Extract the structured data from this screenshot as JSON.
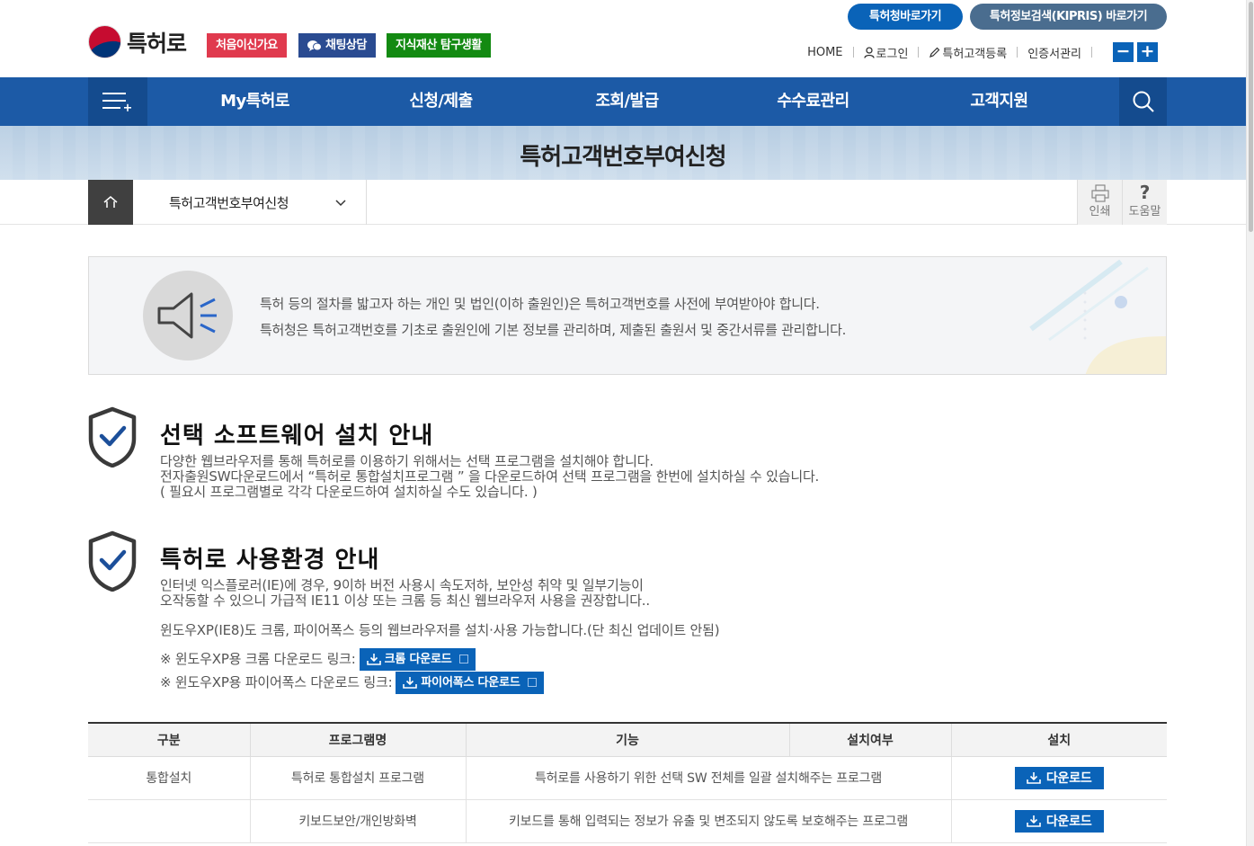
{
  "header": {
    "logo_text": "특허로",
    "tags": {
      "first_visit": "처음이신가요",
      "chat": "채팅상담",
      "ip_life": "지식재산 탐구생활"
    },
    "pills": {
      "kipo": "특허청바로가기",
      "kipris": "특허정보검색(KIPRIS) 바로가기"
    },
    "util": {
      "home": "HOME",
      "login": "로그인",
      "register": "특허고객등록",
      "cert": "인증서관리",
      "zoom_out": "−",
      "zoom_in": "+"
    }
  },
  "nav": {
    "items": [
      "My특허로",
      "신청/제출",
      "조회/발급",
      "수수료관리",
      "고객지원"
    ]
  },
  "banner": {
    "title": "특허고객번호부여신청"
  },
  "breadcrumb": {
    "current": "특허고객번호부여신청",
    "print": "인쇄",
    "help_symbol": "?",
    "help": "도움말"
  },
  "notice": {
    "line1": "특허 등의 절차를 밟고자 하는 개인 및 법인(이하 출원인)은 특허고객번호를 사전에 부여받아야 합니다.",
    "line2": "특허청은 특허고객번호를 기초로 출원인에 기본 정보를 관리하며, 제출된 출원서 및 중간서류를 관리합니다."
  },
  "section_sw": {
    "title": "선택 소프트웨어 설치 안내",
    "line1": "다양한 웹브라우저를 통해 특허로를 이용하기 위해서는 선택 프로그램을 설치해야 합니다.",
    "line2": "전자출원SW다운로드에서 “특허로 통합설치프로그램 ” 을 다운로드하여 선택 프로그램을 한번에 설치하실 수 있습니다.",
    "line3": "( 필요시 프로그램별로 각각 다운로드하여 설치하실 수도 있습니다. )"
  },
  "section_env": {
    "title": "특허로 사용환경 안내",
    "line1": "인터넷 익스플로러(IE)에 경우, 9이하 버전 사용시 속도저하, 보안성 취약 및 일부기능이",
    "line2": "오작동할 수 있으니 가급적 IE11 이상 또는 크롬 등 최신 웹브라우저 사용을 권장합니다..",
    "line3": "윈도우XP(IE8)도 크롬, 파이어폭스 등의 웹브라우저를 설치·사용 가능합니다.(단 최신 업데이트 안됨)",
    "chrome_label": "※ 윈도우XP용 크롬 다운로드 링크:",
    "chrome_btn": "크롬 다운로드",
    "firefox_label": "※ 윈도우XP용 파이어폭스 다운로드 링크:",
    "firefox_btn": "파이어폭스 다운로드"
  },
  "table": {
    "headers": [
      "구분",
      "프로그램명",
      "기능",
      "설치여부",
      "설치"
    ],
    "rows": [
      {
        "category": "통합설치",
        "program": "특허로 통합설치 프로그램",
        "function": "특허로를 사용하기 위한 선택 SW 전체를 일괄 설치해주는 프로그램",
        "installed": "",
        "button": "다운로드"
      },
      {
        "category": "",
        "program": "키보드보안/개인방화벽",
        "function": "키보드를 통해 입력되는 정보가 유출 및 변조되지 않도록 보호해주는 프로그램",
        "installed": "",
        "button": "다운로드"
      }
    ]
  },
  "colors": {
    "nav_blue": "#1c5aa6",
    "accent_blue": "#0a63b8",
    "tag_red": "#e03a4e",
    "tag_navy": "#2a4b91",
    "tag_green": "#138a12",
    "pill_slate": "#4a6d8f"
  }
}
